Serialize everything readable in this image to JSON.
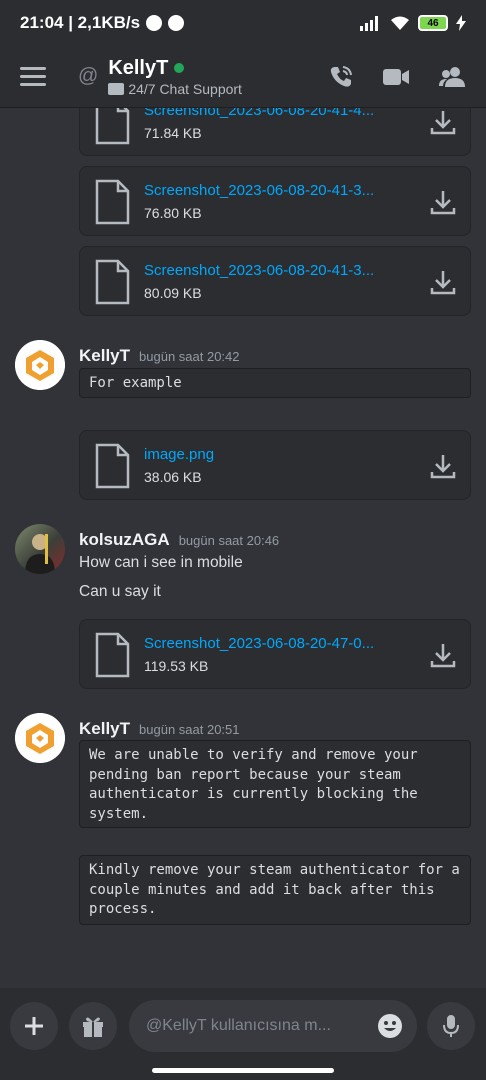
{
  "status_bar": {
    "time_speed": "21:04 | 2,1KB/s",
    "battery": "46"
  },
  "header": {
    "at_symbol": "@",
    "username": "KellyT",
    "status_text": "24/7 Chat Support",
    "icons": [
      "menu-icon",
      "call-icon",
      "video-icon",
      "members-icon"
    ]
  },
  "messages": [
    {
      "author": "KellyT",
      "timestamp": "bugün saat 20:42",
      "code": "For example"
    },
    {
      "author": "kolsuzAGA",
      "timestamp": "bugün saat 20:46",
      "lines": [
        "How can i see in mobile",
        "Can u say it"
      ]
    },
    {
      "author": "KellyT",
      "timestamp": "bugün saat 20:51",
      "code_blocks": [
        "We are unable to verify and remove your\npending ban report because your steam\nauthenticator is currently blocking the\nsystem.",
        "Kindly remove your steam authenticator for a\ncouple minutes and add it back after this\nprocess."
      ]
    }
  ],
  "attachments": [
    {
      "name": "Screenshot_2023-06-08-20-41-4...",
      "size": "71.84 KB"
    },
    {
      "name": "Screenshot_2023-06-08-20-41-3...",
      "size": "76.80 KB"
    },
    {
      "name": "Screenshot_2023-06-08-20-41-3...",
      "size": "80.09 KB"
    },
    {
      "name": "image.png",
      "size": "38.06 KB"
    },
    {
      "name": "Screenshot_2023-06-08-20-47-0...",
      "size": "119.53 KB"
    }
  ],
  "composer": {
    "placeholder": "@KellyT kullanıcısına m..."
  },
  "colors": {
    "background": "#313338",
    "link": "#00a8fc",
    "online": "#23a55a",
    "avatar_accent": "#f0a030"
  }
}
